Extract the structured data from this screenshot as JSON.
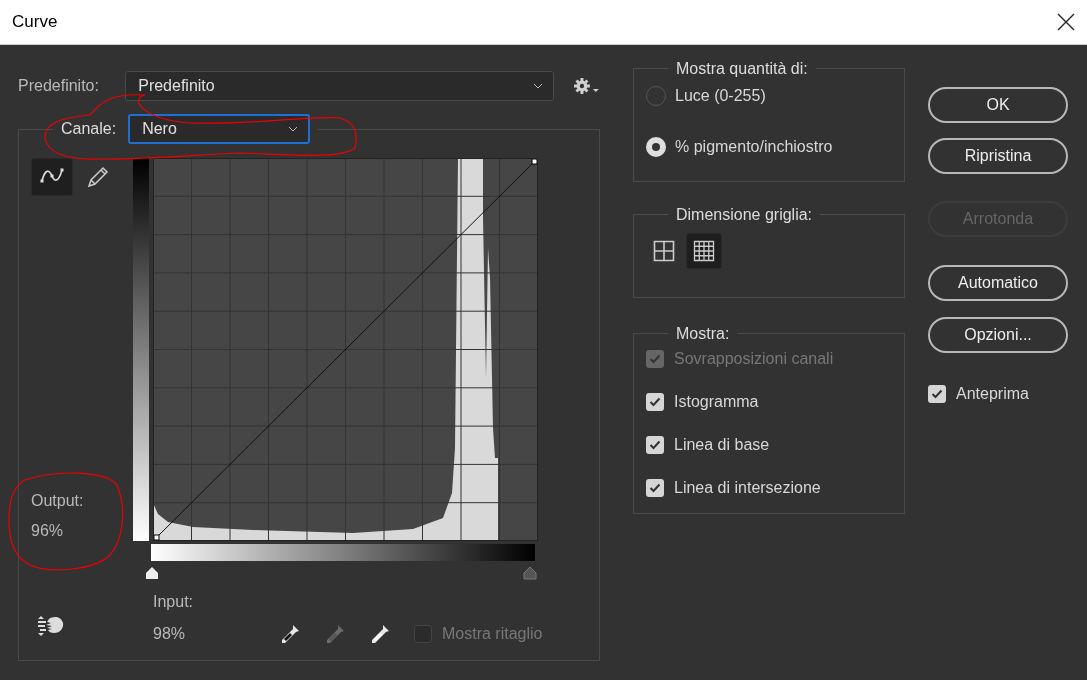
{
  "window": {
    "title": "Curve"
  },
  "preset": {
    "label": "Predefinito:",
    "value": "Predefinito"
  },
  "channel": {
    "label": "Canale:",
    "value": "Nero"
  },
  "tools": [
    {
      "kind": "curve",
      "selected": true
    },
    {
      "kind": "pencil",
      "selected": false
    }
  ],
  "output": {
    "label": "Output:",
    "value": "96%"
  },
  "input": {
    "label": "Input:",
    "value": "98%"
  },
  "eyedroppers": [
    {
      "kind": "black",
      "disabled": false
    },
    {
      "kind": "gray",
      "disabled": true
    },
    {
      "kind": "white",
      "disabled": false
    }
  ],
  "show_clipping": {
    "label": "Mostra ritaglio",
    "checked": false,
    "disabled": true
  },
  "show_amount": {
    "title": "Mostra quantità di:",
    "options": [
      {
        "label": "Luce (0-255)",
        "selected": false
      },
      {
        "label": "% pigmento/inchiostro",
        "selected": true
      }
    ]
  },
  "grid_size": {
    "title": "Dimensione griglia:",
    "options": [
      {
        "kind": "simple",
        "selected": false
      },
      {
        "kind": "detailed",
        "selected": true
      }
    ]
  },
  "show": {
    "title": "Mostra:",
    "options": [
      {
        "label": "Sovrapposizioni canali",
        "checked": true,
        "disabled": true
      },
      {
        "label": "Istogramma",
        "checked": true,
        "disabled": false
      },
      {
        "label": "Linea di base",
        "checked": true,
        "disabled": false
      },
      {
        "label": "Linea di intersezione",
        "checked": true,
        "disabled": false
      }
    ]
  },
  "buttons": [
    {
      "label": "OK",
      "disabled": false
    },
    {
      "label": "Ripristina",
      "disabled": false
    },
    {
      "label": "Arrotonda",
      "disabled": true
    },
    {
      "label": "Automatico",
      "disabled": false
    },
    {
      "label": "Opzioni...",
      "disabled": false
    }
  ],
  "preview": {
    "label": "Anteprima",
    "checked": true
  }
}
